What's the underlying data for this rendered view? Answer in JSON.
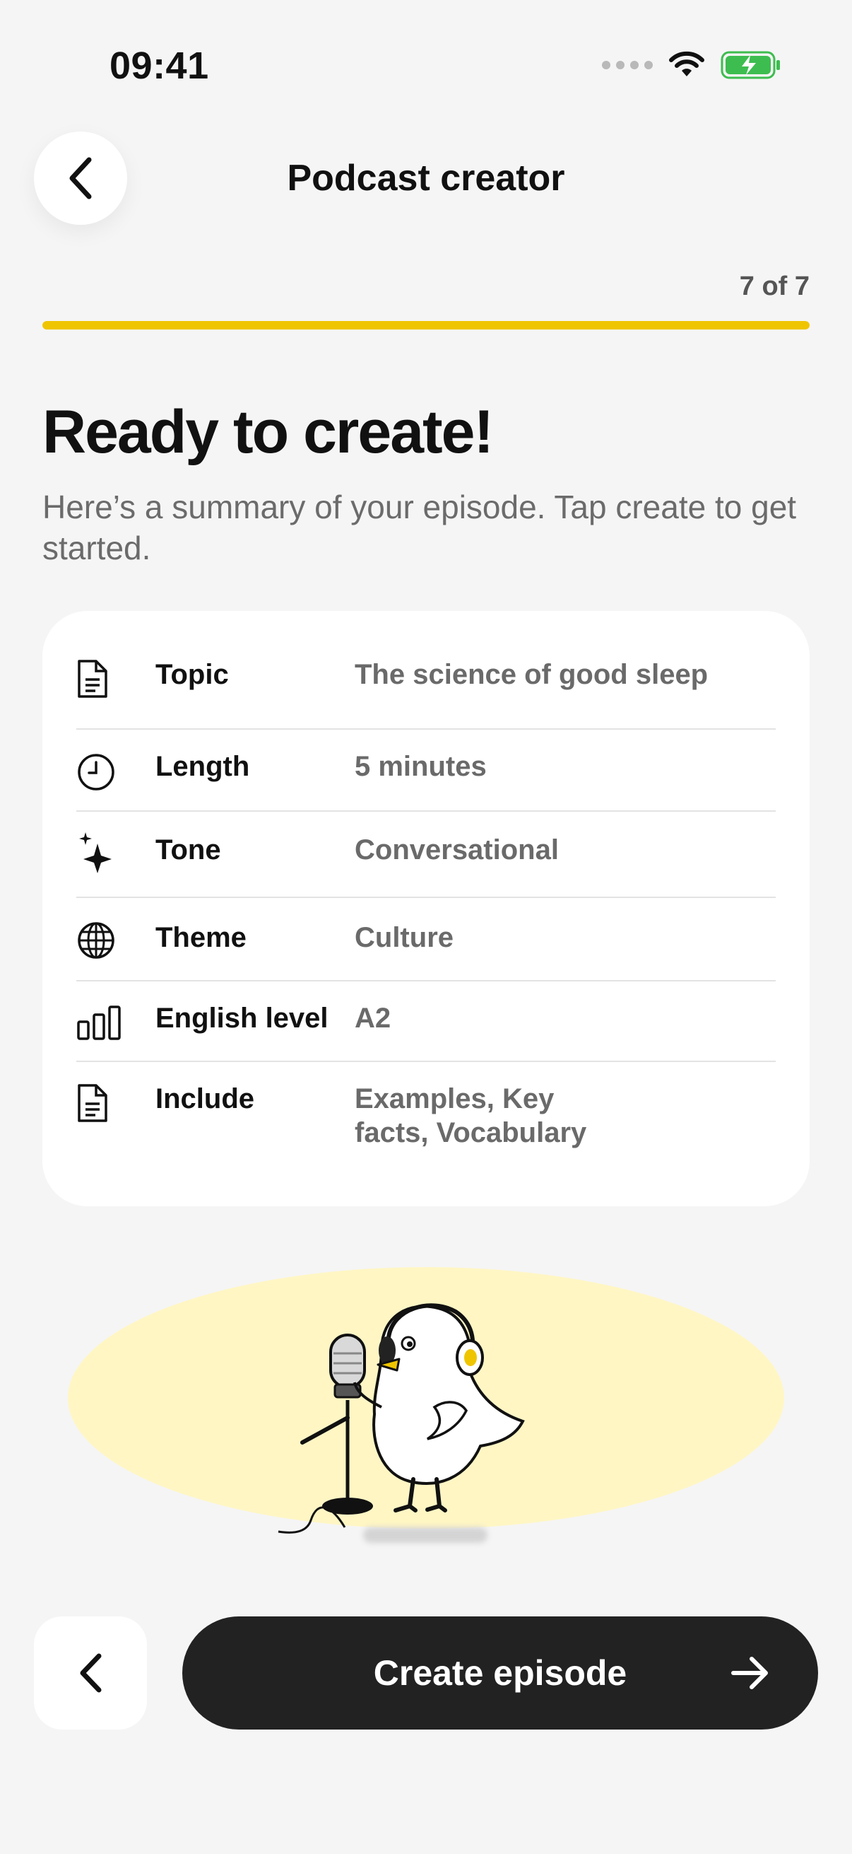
{
  "status_bar": {
    "time": "09:41"
  },
  "header": {
    "title": "Podcast creator",
    "step": "7 of 7",
    "progress_fraction": 1.0
  },
  "main": {
    "heading": "Ready to create!",
    "subtitle": "Here’s a summary of your episode. Tap create to get started."
  },
  "summary": {
    "rows": [
      {
        "icon": "document-icon",
        "label": "Topic",
        "value": "The science of good sleep"
      },
      {
        "icon": "clock-icon",
        "label": "Length",
        "value": "5 minutes"
      },
      {
        "icon": "sparkle-icon",
        "label": "Tone",
        "value": "Conversational"
      },
      {
        "icon": "globe-icon",
        "label": "Theme",
        "value": "Culture"
      },
      {
        "icon": "bar-chart-icon",
        "label": "English level",
        "value": "A2"
      },
      {
        "icon": "document-icon",
        "label": "Include",
        "value": "Examples, Key facts, Vocabulary"
      }
    ]
  },
  "footer": {
    "create_label": "Create episode"
  },
  "colors": {
    "accent": "#efc500",
    "button_dark": "#222222",
    "illustration_bg": "#fff6c4"
  }
}
